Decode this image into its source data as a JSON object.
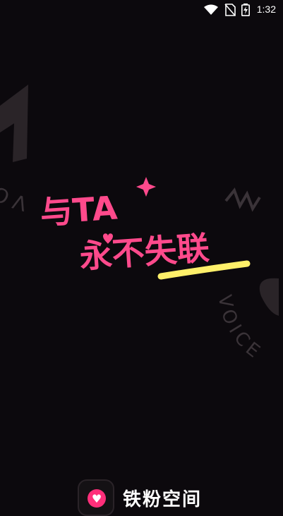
{
  "status_bar": {
    "time": "1:32",
    "icons": [
      "wifi-icon",
      "no-sim-icon",
      "battery-charging-icon"
    ]
  },
  "background": {
    "ring_text_left": "VOICE PLAIN",
    "ring_text_right": "VOICE",
    "colors": {
      "background": "#0c090d",
      "ring": "#3a3338"
    }
  },
  "headline": {
    "line1": "与TA",
    "line2": "永不失联",
    "colors": {
      "text": "#ff4a8c",
      "underline": "#fff06a"
    }
  },
  "brand": {
    "app_name": "铁粉空间",
    "icon": "heart-icon",
    "colors": {
      "icon_bg": "#ff2f7a"
    }
  }
}
